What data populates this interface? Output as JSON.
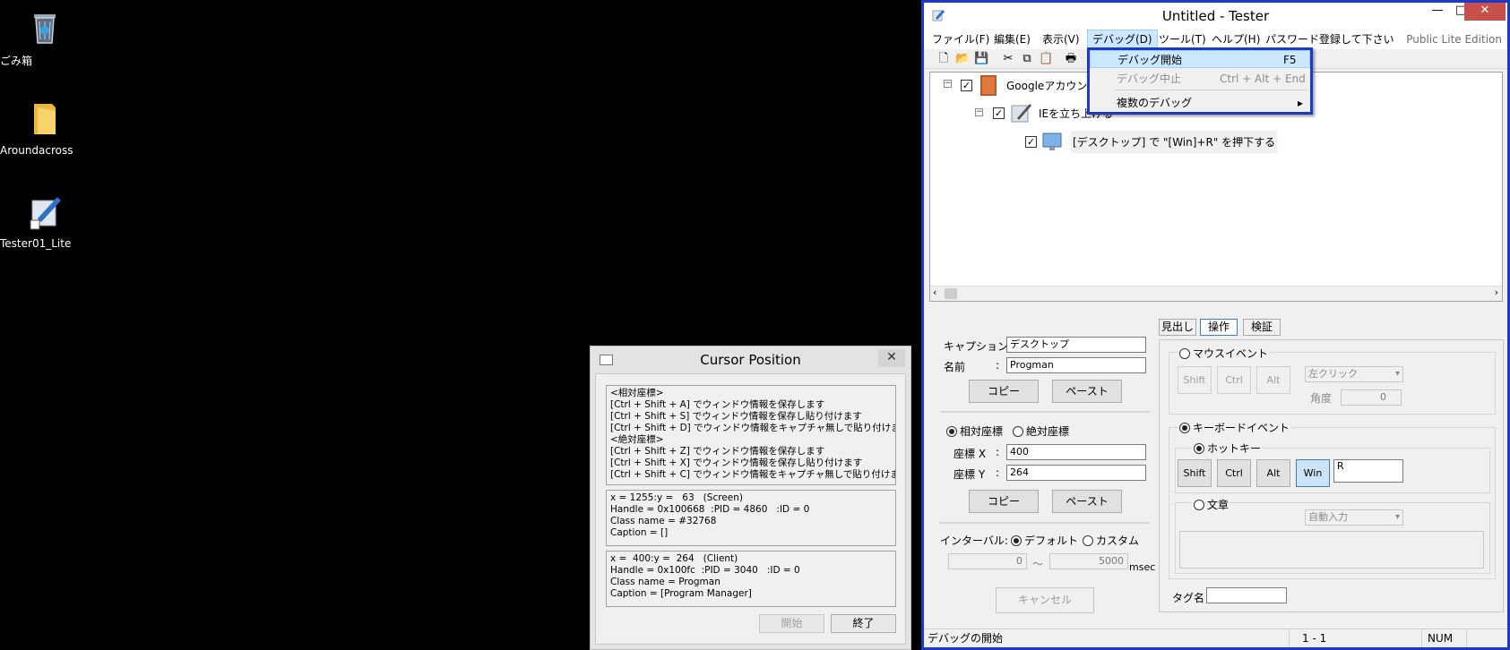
{
  "desktop": {
    "icons": [
      {
        "label": "ごみ箱"
      },
      {
        "label": "Aroundacross"
      },
      {
        "label": "Tester01_Lite"
      }
    ]
  },
  "cursor_window": {
    "title": "Cursor Position",
    "close_glyph": "✕",
    "box1": "<相対座標>\n[Ctrl + Shift + A] でウィンドウ情報を保存します\n[Ctrl + Shift + S] でウィンドウ情報を保存し貼り付けます\n[Ctrl + Shift + D] でウィンドウ情報をキャプチャ無しで貼り付けます\n<絶対座標>\n[Ctrl + Shift + Z] でウィンドウ情報を保存します\n[Ctrl + Shift + X] でウィンドウ情報を保存し貼り付けます\n[Ctrl + Shift + C] でウィンドウ情報をキャプチャ無しで貼り付けます",
    "box2": "x = 1255:y =   63   (Screen)\nHandle = 0x100668  :PID = 4860   :ID = 0\nClass name = #32768\nCaption = []",
    "box3": "x =  400:y =  264   (Client)\nHandle = 0x100fc  :PID = 3040   :ID = 0\nClass name = Progman\nCaption = [Program Manager]",
    "start_label": "開始",
    "end_label": "終了"
  },
  "tester": {
    "title": "Untitled - Tester",
    "min_glyph": "—",
    "max_glyph": "□",
    "close_glyph": "✕",
    "menu": [
      "ファイル(F)",
      "編集(E)",
      "表示(V)",
      "デバッグ(D)",
      "ツール(T)",
      "ヘルプ(H)",
      "パスワード登録して下さい"
    ],
    "edition": "Public Lite Edition",
    "tree": [
      {
        "label": "Googleアカウント"
      },
      {
        "label": "IEを立ち上げる"
      },
      {
        "label": "[デスクトップ] で \"[Win]+R\" を押下する"
      }
    ],
    "dropdown": [
      {
        "label": "デバッグ開始",
        "key": "F5"
      },
      {
        "label": "デバッグ中止",
        "key": "Ctrl + Alt + End"
      },
      {
        "label": "複数のデバッグ",
        "key": "▸"
      }
    ],
    "caption_label": "キャプション:",
    "caption_value": "デスクトップ",
    "name_label": "名前",
    "name_colon": ":",
    "name_value": "Progman",
    "copy_label": "コピー",
    "paste_label": "ペースト",
    "relative_label": "相対座標",
    "absolute_label": "絶対座標",
    "x_label": "座標 X",
    "y_label": "座標 Y",
    "coord_colon": ":",
    "x_value": "400",
    "y_value": "264",
    "interval_label": "インターバル:",
    "default_label": "デフォルト",
    "custom_label": "カスタム",
    "interval_min": "0",
    "interval_max": "5000",
    "interval_sep": "～",
    "msec_label": "msec",
    "cancel_label": "キャンセル",
    "tabs": [
      "見出し",
      "操作",
      "検証"
    ],
    "mouse_event_label": "マウスイベント",
    "shift_label": "Shift",
    "ctrl_label": "Ctrl",
    "alt_label": "Alt",
    "win_label": "Win",
    "click_select": "左クリック",
    "angle_label": "角度",
    "angle_value": "0",
    "keyboard_event_label": "キーボードイベント",
    "hotkey_label": "ホットキー",
    "hotkey_value": "R",
    "text_label": "文章",
    "auto_input_select": "自動入力",
    "tag_label": "タグ名",
    "status_text": "デバッグの開始",
    "status_pos": "1 -   1",
    "status_num": "NUM"
  }
}
